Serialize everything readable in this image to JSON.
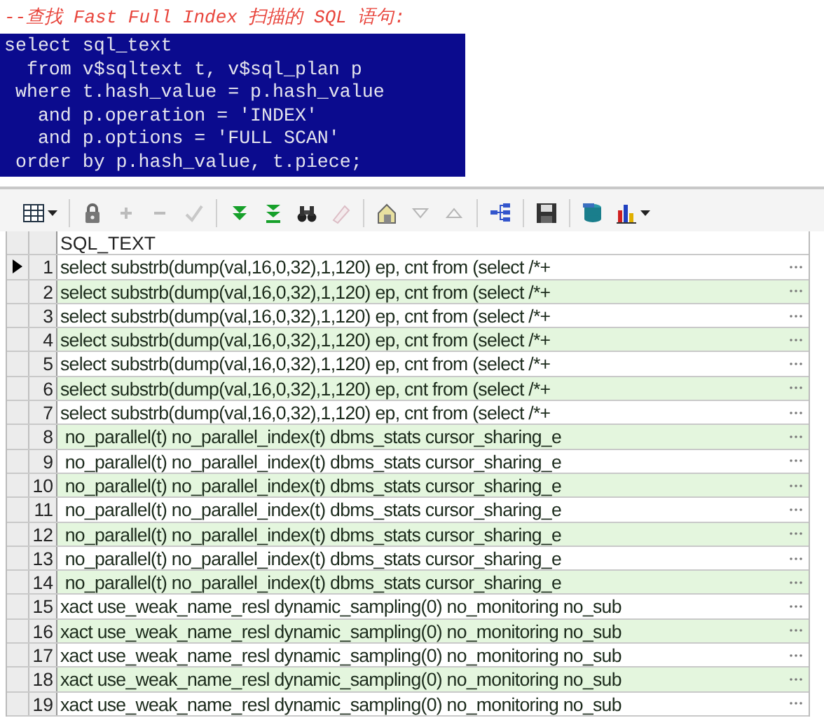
{
  "comment": "--查找 Fast Full Index 扫描的 SQL 语句:",
  "code_lines": [
    "select sql_text",
    "  from v$sqltext t, v$sql_plan p",
    " where t.hash_value = p.hash_value",
    "   and p.operation = 'INDEX'",
    "   and p.options = 'FULL SCAN'",
    " order by p.hash_value, t.piece;"
  ],
  "toolbar": [
    [
      {
        "kind": "grid",
        "dropdown": true,
        "disabled": false
      }
    ],
    [
      {
        "kind": "lock",
        "dropdown": false,
        "disabled": false
      },
      {
        "kind": "plus",
        "dropdown": false,
        "disabled": true
      },
      {
        "kind": "minus",
        "dropdown": false,
        "disabled": true
      },
      {
        "kind": "check",
        "dropdown": false,
        "disabled": true
      }
    ],
    [
      {
        "kind": "fetch-next",
        "dropdown": false,
        "disabled": false
      },
      {
        "kind": "fetch-last",
        "dropdown": false,
        "disabled": false
      },
      {
        "kind": "binoculars",
        "dropdown": false,
        "disabled": false
      },
      {
        "kind": "eraser",
        "dropdown": false,
        "disabled": true
      }
    ],
    [
      {
        "kind": "house",
        "dropdown": false,
        "disabled": false
      },
      {
        "kind": "triangle-down",
        "dropdown": false,
        "disabled": true
      },
      {
        "kind": "triangle-up",
        "dropdown": false,
        "disabled": true
      }
    ],
    [
      {
        "kind": "tree",
        "dropdown": false,
        "disabled": false
      }
    ],
    [
      {
        "kind": "save",
        "dropdown": false,
        "disabled": false
      }
    ],
    [
      {
        "kind": "database",
        "dropdown": false,
        "disabled": false
      },
      {
        "kind": "chart",
        "dropdown": true,
        "disabled": false
      }
    ]
  ],
  "grid": {
    "columns": [
      "SQL_TEXT"
    ],
    "rows": [
      {
        "number": "1",
        "text": "select substrb(dump(val,16,0,32),1,120) ep, cnt from (select /*+",
        "selected": true
      },
      {
        "number": "2",
        "text": "select substrb(dump(val,16,0,32),1,120) ep, cnt from (select /*+",
        "selected": false
      },
      {
        "number": "3",
        "text": "select substrb(dump(val,16,0,32),1,120) ep, cnt from (select /*+",
        "selected": false
      },
      {
        "number": "4",
        "text": "select substrb(dump(val,16,0,32),1,120) ep, cnt from (select /*+",
        "selected": false
      },
      {
        "number": "5",
        "text": "select substrb(dump(val,16,0,32),1,120) ep, cnt from (select /*+",
        "selected": false
      },
      {
        "number": "6",
        "text": "select substrb(dump(val,16,0,32),1,120) ep, cnt from (select /*+",
        "selected": false
      },
      {
        "number": "7",
        "text": "select substrb(dump(val,16,0,32),1,120) ep, cnt from (select /*+",
        "selected": false
      },
      {
        "number": "8",
        "text": " no_parallel(t) no_parallel_index(t) dbms_stats cursor_sharing_e",
        "selected": false
      },
      {
        "number": "9",
        "text": " no_parallel(t) no_parallel_index(t) dbms_stats cursor_sharing_e",
        "selected": false
      },
      {
        "number": "10",
        "text": " no_parallel(t) no_parallel_index(t) dbms_stats cursor_sharing_e",
        "selected": false
      },
      {
        "number": "11",
        "text": " no_parallel(t) no_parallel_index(t) dbms_stats cursor_sharing_e",
        "selected": false
      },
      {
        "number": "12",
        "text": " no_parallel(t) no_parallel_index(t) dbms_stats cursor_sharing_e",
        "selected": false
      },
      {
        "number": "13",
        "text": " no_parallel(t) no_parallel_index(t) dbms_stats cursor_sharing_e",
        "selected": false
      },
      {
        "number": "14",
        "text": " no_parallel(t) no_parallel_index(t) dbms_stats cursor_sharing_e",
        "selected": false
      },
      {
        "number": "15",
        "text": "xact use_weak_name_resl dynamic_sampling(0) no_monitoring no_sub",
        "selected": false
      },
      {
        "number": "16",
        "text": "xact use_weak_name_resl dynamic_sampling(0) no_monitoring no_sub",
        "selected": false
      },
      {
        "number": "17",
        "text": "xact use_weak_name_resl dynamic_sampling(0) no_monitoring no_sub",
        "selected": false
      },
      {
        "number": "18",
        "text": "xact use_weak_name_resl dynamic_sampling(0) no_monitoring no_sub",
        "selected": false
      },
      {
        "number": "19",
        "text": "xact use_weak_name_resl dynamic_sampling(0) no_monitoring no_sub",
        "selected": false
      }
    ]
  }
}
